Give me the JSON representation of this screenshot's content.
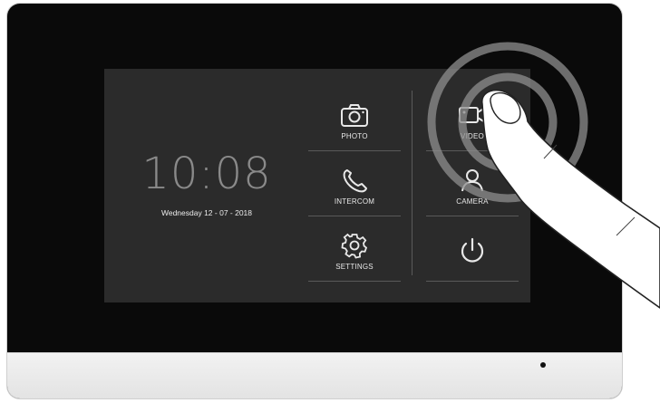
{
  "screen": {
    "time": "10:08",
    "date": "Wednesday 12 - 07 - 2018"
  },
  "menu": {
    "photo": {
      "label": "PHOTO",
      "icon": "camera-icon"
    },
    "video": {
      "label": "VIDEO",
      "icon": "video-camera-icon"
    },
    "intercom": {
      "label": "INTERCOM",
      "icon": "phone-icon"
    },
    "camera": {
      "label": "CAMERA",
      "icon": "person-icon"
    },
    "settings": {
      "label": "SETTINGS",
      "icon": "gear-icon"
    },
    "power": {
      "icon": "power-icon"
    }
  },
  "colors": {
    "bezel": "#0a0a0a",
    "screen": "#2b2b2b",
    "clock": "#8a8a8a",
    "text": "#e8e8e8"
  }
}
